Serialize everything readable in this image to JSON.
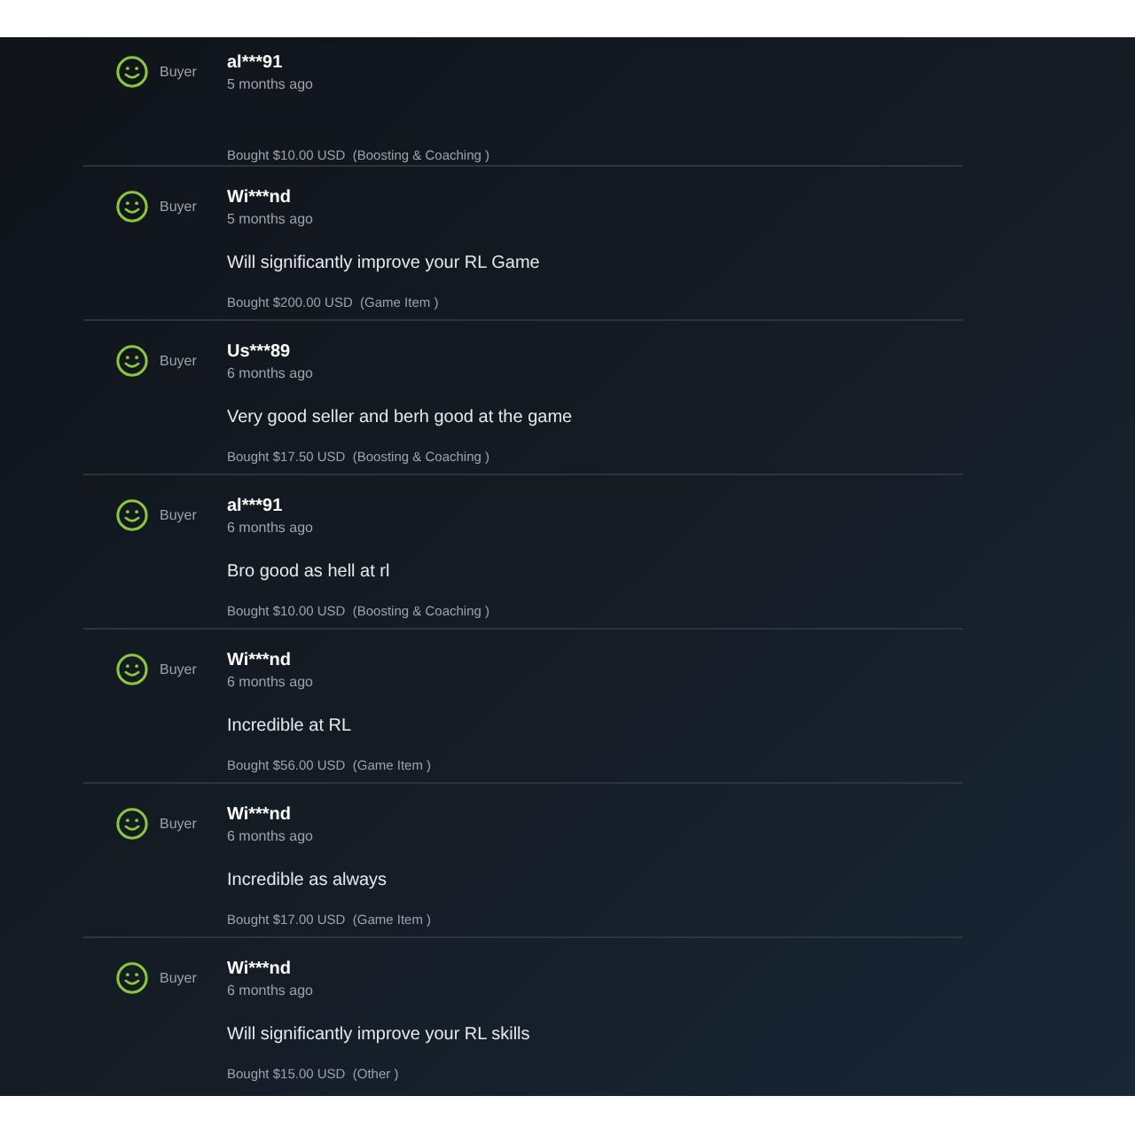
{
  "reviews": [
    {
      "role": "Buyer",
      "user": "al***91",
      "time": "5 months ago",
      "purchase": "Bought $10.00 USD  (Boosting & Coaching )"
    },
    {
      "role": "Buyer",
      "user": "Wi***nd",
      "time": "5 months ago",
      "comment": "Will significantly improve your RL Game",
      "purchase": "Bought $200.00 USD  (Game Item )"
    },
    {
      "role": "Buyer",
      "user": "Us***89",
      "time": "6 months ago",
      "comment": "Very good seller and berh good at the game",
      "purchase": "Bought $17.50 USD  (Boosting & Coaching )"
    },
    {
      "role": "Buyer",
      "user": "al***91",
      "time": "6 months ago",
      "comment": "Bro good as hell at rl",
      "purchase": "Bought $10.00 USD  (Boosting & Coaching )"
    },
    {
      "role": "Buyer",
      "user": "Wi***nd",
      "time": "6 months ago",
      "comment": "Incredible at RL",
      "purchase": "Bought $56.00 USD  (Game Item )"
    },
    {
      "role": "Buyer",
      "user": "Wi***nd",
      "time": "6 months ago",
      "comment": "Incredible as always",
      "purchase": "Bought $17.00 USD  (Game Item )"
    },
    {
      "role": "Buyer",
      "user": "Wi***nd",
      "time": "6 months ago",
      "comment": "Will significantly improve your RL skills",
      "purchase": "Bought $15.00 USD  (Other )"
    }
  ]
}
